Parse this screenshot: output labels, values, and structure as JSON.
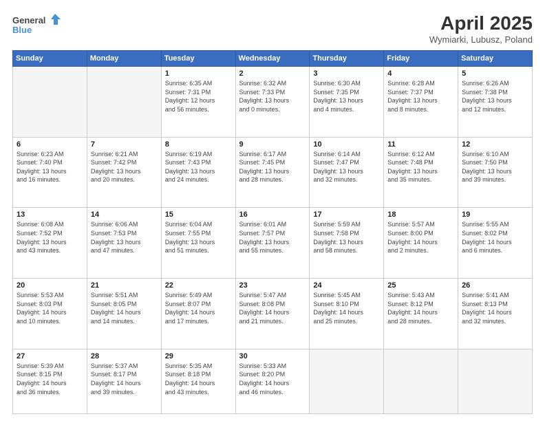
{
  "header": {
    "logo_general": "General",
    "logo_blue": "Blue",
    "title": "April 2025",
    "location": "Wymiarki, Lubusz, Poland"
  },
  "days_of_week": [
    "Sunday",
    "Monday",
    "Tuesday",
    "Wednesday",
    "Thursday",
    "Friday",
    "Saturday"
  ],
  "weeks": [
    [
      {
        "day": "",
        "detail": ""
      },
      {
        "day": "",
        "detail": ""
      },
      {
        "day": "1",
        "detail": "Sunrise: 6:35 AM\nSunset: 7:31 PM\nDaylight: 12 hours\nand 56 minutes."
      },
      {
        "day": "2",
        "detail": "Sunrise: 6:32 AM\nSunset: 7:33 PM\nDaylight: 13 hours\nand 0 minutes."
      },
      {
        "day": "3",
        "detail": "Sunrise: 6:30 AM\nSunset: 7:35 PM\nDaylight: 13 hours\nand 4 minutes."
      },
      {
        "day": "4",
        "detail": "Sunrise: 6:28 AM\nSunset: 7:37 PM\nDaylight: 13 hours\nand 8 minutes."
      },
      {
        "day": "5",
        "detail": "Sunrise: 6:26 AM\nSunset: 7:38 PM\nDaylight: 13 hours\nand 12 minutes."
      }
    ],
    [
      {
        "day": "6",
        "detail": "Sunrise: 6:23 AM\nSunset: 7:40 PM\nDaylight: 13 hours\nand 16 minutes."
      },
      {
        "day": "7",
        "detail": "Sunrise: 6:21 AM\nSunset: 7:42 PM\nDaylight: 13 hours\nand 20 minutes."
      },
      {
        "day": "8",
        "detail": "Sunrise: 6:19 AM\nSunset: 7:43 PM\nDaylight: 13 hours\nand 24 minutes."
      },
      {
        "day": "9",
        "detail": "Sunrise: 6:17 AM\nSunset: 7:45 PM\nDaylight: 13 hours\nand 28 minutes."
      },
      {
        "day": "10",
        "detail": "Sunrise: 6:14 AM\nSunset: 7:47 PM\nDaylight: 13 hours\nand 32 minutes."
      },
      {
        "day": "11",
        "detail": "Sunrise: 6:12 AM\nSunset: 7:48 PM\nDaylight: 13 hours\nand 35 minutes."
      },
      {
        "day": "12",
        "detail": "Sunrise: 6:10 AM\nSunset: 7:50 PM\nDaylight: 13 hours\nand 39 minutes."
      }
    ],
    [
      {
        "day": "13",
        "detail": "Sunrise: 6:08 AM\nSunset: 7:52 PM\nDaylight: 13 hours\nand 43 minutes."
      },
      {
        "day": "14",
        "detail": "Sunrise: 6:06 AM\nSunset: 7:53 PM\nDaylight: 13 hours\nand 47 minutes."
      },
      {
        "day": "15",
        "detail": "Sunrise: 6:04 AM\nSunset: 7:55 PM\nDaylight: 13 hours\nand 51 minutes."
      },
      {
        "day": "16",
        "detail": "Sunrise: 6:01 AM\nSunset: 7:57 PM\nDaylight: 13 hours\nand 55 minutes."
      },
      {
        "day": "17",
        "detail": "Sunrise: 5:59 AM\nSunset: 7:58 PM\nDaylight: 13 hours\nand 58 minutes."
      },
      {
        "day": "18",
        "detail": "Sunrise: 5:57 AM\nSunset: 8:00 PM\nDaylight: 14 hours\nand 2 minutes."
      },
      {
        "day": "19",
        "detail": "Sunrise: 5:55 AM\nSunset: 8:02 PM\nDaylight: 14 hours\nand 6 minutes."
      }
    ],
    [
      {
        "day": "20",
        "detail": "Sunrise: 5:53 AM\nSunset: 8:03 PM\nDaylight: 14 hours\nand 10 minutes."
      },
      {
        "day": "21",
        "detail": "Sunrise: 5:51 AM\nSunset: 8:05 PM\nDaylight: 14 hours\nand 14 minutes."
      },
      {
        "day": "22",
        "detail": "Sunrise: 5:49 AM\nSunset: 8:07 PM\nDaylight: 14 hours\nand 17 minutes."
      },
      {
        "day": "23",
        "detail": "Sunrise: 5:47 AM\nSunset: 8:08 PM\nDaylight: 14 hours\nand 21 minutes."
      },
      {
        "day": "24",
        "detail": "Sunrise: 5:45 AM\nSunset: 8:10 PM\nDaylight: 14 hours\nand 25 minutes."
      },
      {
        "day": "25",
        "detail": "Sunrise: 5:43 AM\nSunset: 8:12 PM\nDaylight: 14 hours\nand 28 minutes."
      },
      {
        "day": "26",
        "detail": "Sunrise: 5:41 AM\nSunset: 8:13 PM\nDaylight: 14 hours\nand 32 minutes."
      }
    ],
    [
      {
        "day": "27",
        "detail": "Sunrise: 5:39 AM\nSunset: 8:15 PM\nDaylight: 14 hours\nand 36 minutes."
      },
      {
        "day": "28",
        "detail": "Sunrise: 5:37 AM\nSunset: 8:17 PM\nDaylight: 14 hours\nand 39 minutes."
      },
      {
        "day": "29",
        "detail": "Sunrise: 5:35 AM\nSunset: 8:18 PM\nDaylight: 14 hours\nand 43 minutes."
      },
      {
        "day": "30",
        "detail": "Sunrise: 5:33 AM\nSunset: 8:20 PM\nDaylight: 14 hours\nand 46 minutes."
      },
      {
        "day": "",
        "detail": ""
      },
      {
        "day": "",
        "detail": ""
      },
      {
        "day": "",
        "detail": ""
      }
    ]
  ]
}
